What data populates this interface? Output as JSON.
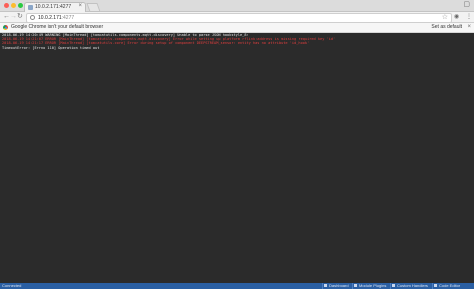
{
  "browser": {
    "tab_title": "10.0.2.171:4277",
    "url_host": "10.0.2.171",
    "url_port": ":4277",
    "infobar_text": "Google Chrome isn't your default browser",
    "set_default_label": "Set as default"
  },
  "console": {
    "lines": [
      {
        "level": "warn",
        "text": "2018-06-19 14:20:49 WARNING [MainThread] [tomcatutils.components.mqtt.discovery] Unable to parse JSON hookstyle_8:"
      },
      {
        "level": "error",
        "text": "2018-06-19 14:21:07 ERROR [MainThread] [tomcatutils.components.mqtt.discovery] Error while setting up platform rflink:address is missing required key 'id'"
      },
      {
        "level": "error",
        "text": "2018-06-19 14:21:17 ERROR [MainThread] [tomcatutils.core] Error during setup of component DEEPSTREAM_sensor: entity has no attribute 'id_hook'"
      },
      {
        "level": "plain",
        "text": "TimeoutError: [Errno 110] Operation timed out"
      }
    ]
  },
  "statusbar": {
    "left_text": "Connected",
    "items": [
      "Dashboard",
      "Module Plugins",
      "Custom Handlers",
      "Code Editor"
    ]
  },
  "colors": {
    "console_bg": "#2b2b2b",
    "error": "#e33e3e",
    "statusbar": "#2a5fa3"
  }
}
